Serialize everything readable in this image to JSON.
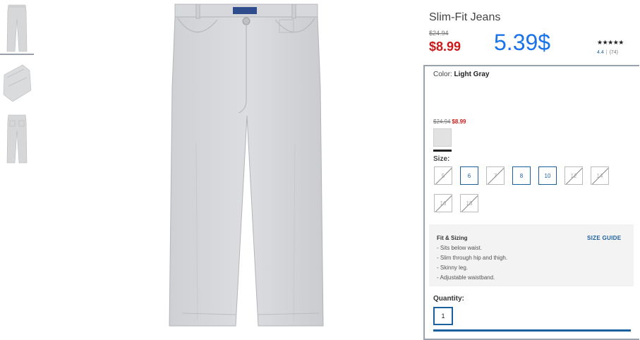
{
  "product": {
    "title": "Slim-Fit Jeans",
    "original_price": "$24.94",
    "sale_price": "$8.99",
    "overlay_price": "5.39$",
    "stars": "★★★★★",
    "rating": "4.4",
    "review_count": "(74)"
  },
  "options": {
    "color_label": "Color:",
    "color_value": "Light Gray",
    "swatch_original_price": "$24.94",
    "swatch_sale_price": "$8.99",
    "swatch_color": "#e2e2e2",
    "size_label": "Size:",
    "sizes": [
      {
        "label": "5",
        "available": false
      },
      {
        "label": "6",
        "available": true
      },
      {
        "label": "7",
        "available": false
      },
      {
        "label": "8",
        "available": true
      },
      {
        "label": "10",
        "available": true
      },
      {
        "label": "12",
        "available": false
      },
      {
        "label": "14",
        "available": false
      },
      {
        "label": "16",
        "available": false
      },
      {
        "label": "18",
        "available": false
      }
    ]
  },
  "fit": {
    "title": "Fit & Sizing",
    "size_guide": "SIZE GUIDE",
    "lines": [
      "- Sits below waist.",
      "- Slim through hip and thigh.",
      "- Skinny leg.",
      "- Adjustable waistband."
    ]
  },
  "quantity": {
    "label": "Quantity:",
    "value": "1"
  },
  "colors": {
    "sale_red": "#cc1a1a",
    "link_blue": "#1a5f9e",
    "overlay_blue": "#1a73e8",
    "jeans_gray": "#d8d9db"
  },
  "icons": [
    "jeans-thumbnail-front",
    "jeans-thumbnail-folded",
    "jeans-thumbnail-back"
  ]
}
